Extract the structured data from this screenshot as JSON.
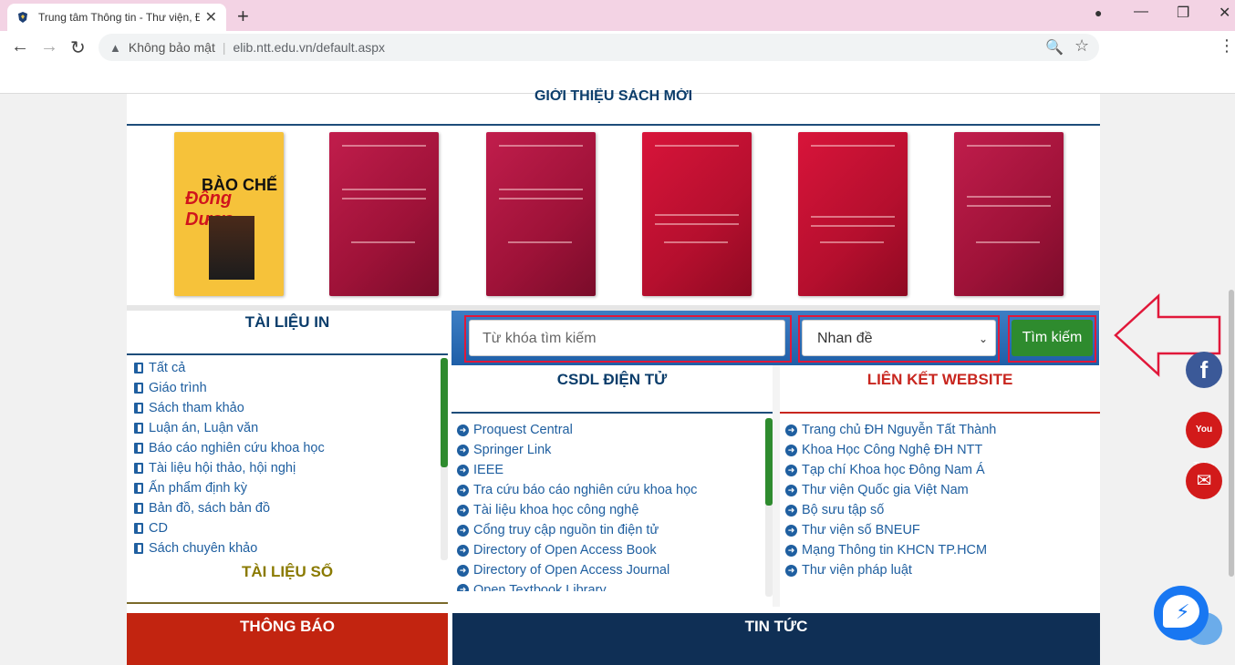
{
  "browser": {
    "tab_title": "Trung tâm Thông tin - Thư viện, Đ",
    "tab_close": "✕",
    "new_tab": "+",
    "security_label": "Không bảo mật",
    "url": "elib.ntt.edu.vn/default.aspx",
    "back": "←",
    "forward": "→",
    "reload": "↻",
    "zoom_icon": "🔍",
    "star_icon": "☆",
    "menu_icon": "⋮",
    "profile_icon": "●",
    "minimize": "—",
    "maximize": "❐",
    "close": "✕"
  },
  "page": {
    "new_books_title": "GIỚI THIỆU SÁCH MỚI",
    "book1": {
      "line1": "BÀO CHẾ",
      "line2": "Đông Dược"
    },
    "tai_lieu_in": {
      "heading": "TÀI LIỆU IN",
      "items": [
        "Tất cả",
        "Giáo trình",
        "Sách tham khảo",
        "Luận án, Luận văn",
        "Báo cáo nghiên cứu khoa học",
        "Tài liệu hội thảo, hội nghị",
        "Ấn phẩm định kỳ",
        "Bản đồ, sách bản đồ",
        "CD",
        "Sách chuyên khảo"
      ]
    },
    "tai_lieu_so": {
      "heading": "TÀI LIỆU SỐ"
    },
    "search": {
      "placeholder": "Từ khóa tìm kiếm",
      "select_value": "Nhan đề",
      "button": "Tìm kiếm"
    },
    "csdl": {
      "heading": "CSDL ĐIỆN TỬ",
      "items": [
        "Proquest Central",
        "Springer Link",
        "IEEE",
        "Tra cứu báo cáo nghiên cứu khoa học",
        "Tài liệu khoa học công nghệ",
        "Cổng truy cập nguồn tin điện tử",
        "Directory of Open Access Book",
        "Directory of Open Access Journal",
        "Open Textbook Library"
      ]
    },
    "lien_ket": {
      "heading": "LIÊN KẾT WEBSITE",
      "items": [
        "Trang chủ ĐH Nguyễn Tất Thành",
        "Khoa Học Công Nghệ ĐH NTT",
        "Tạp chí Khoa học Đông Nam Á",
        "Thư viện Quốc gia Việt Nam",
        "Bộ sưu tập số",
        "Thư viện số BNEUF",
        "Mạng Thông tin KHCN TP.HCM",
        "Thư viện pháp luật"
      ]
    },
    "thong_bao": "THÔNG BÁO",
    "tin_tuc": "TIN TỨC",
    "social": {
      "facebook": "f",
      "youtube": "You Tube",
      "mail": "✉"
    }
  },
  "colors": {
    "brand_blue": "#0b3d6b",
    "accent_red": "#c8261f",
    "search_green": "#2e8b2e",
    "highlight_frame": "#e1183a"
  }
}
